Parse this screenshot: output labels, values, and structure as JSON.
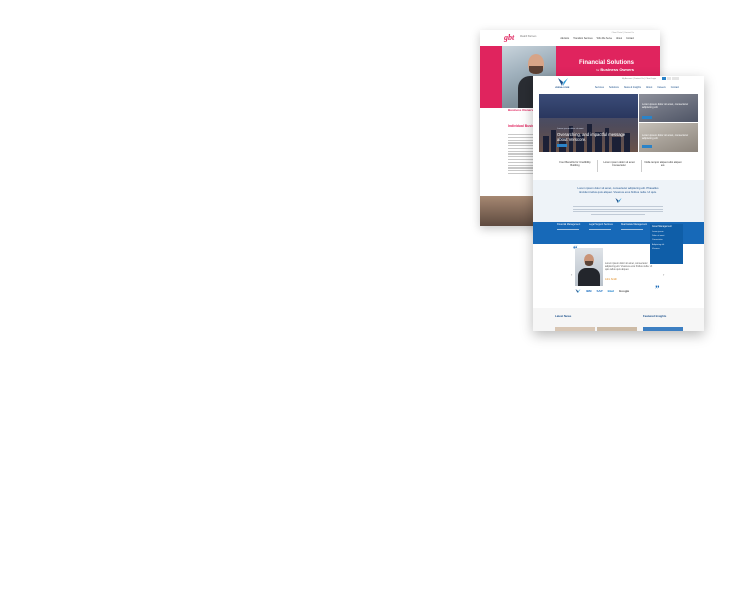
{
  "back_site": {
    "logo": "gbt",
    "tagline": "Wealth Partners",
    "utility": "Client Portal   |   Contact Us",
    "nav": [
      "Advisors",
      "Transition Services",
      "Who We Serve",
      "About",
      "Contact"
    ],
    "hero_title": "Financial Solutions",
    "hero_sub_prefix": "for",
    "hero_sub": "Business Owners",
    "hero_label": "Business Owners",
    "section_title": "Individual Business"
  },
  "front_site": {
    "logo_text": "VERSA CORE",
    "utility": "My Account   |   Contact Us   |   Client Login",
    "nav": [
      "Services",
      "Solutions",
      "News & Insights",
      "About",
      "Careers",
      "Contact"
    ],
    "hero_kicker": "Lorem ipsum dolor sit amet",
    "hero_title": "Overarching, and impactful message about Verscore.",
    "side1_text": "Lorem ipsum dolor sit amet, consectetur adipiscing elit",
    "side2_text": "Lorem ipsum dolor sit amet, consectetur adipiscing elit",
    "stats": [
      "Four Benefits for Credibility Building",
      "Lorem ipsum dolor sit amet Consectetur",
      "Nulla tempor aliquet odio aliquet est."
    ],
    "intro_title": "Lorem ipsum dolor sit amet, consectetur adipiscing elit. Phasellus tincidunt tellus quis aliquet. Vivamus eros finibus nulla. Ut quis.",
    "services": [
      "Financial Management",
      "Legal Support Services",
      "Real Estate Management",
      "Asset Management"
    ],
    "dropdown": [
      "Lorem ipsum",
      "Dolor sit amet",
      "Consectetur",
      "Adipiscing elit",
      "Vivamus"
    ],
    "quote": "Lorem ipsum dolor sit amet, consectetur adipiscing elit. Vivamus eros finibus nulla. Ut quis tellus quis aliquet.",
    "quote_author": "John Smith",
    "logos": [
      "IBM",
      "SAP",
      "Intel",
      "Google"
    ],
    "latest_news": "Latest News",
    "featured_insights": "Featured Insights"
  },
  "colors": {
    "back_accent": "#e0245e",
    "front_accent": "#1769b8",
    "front_navy": "#1a4f8a"
  }
}
